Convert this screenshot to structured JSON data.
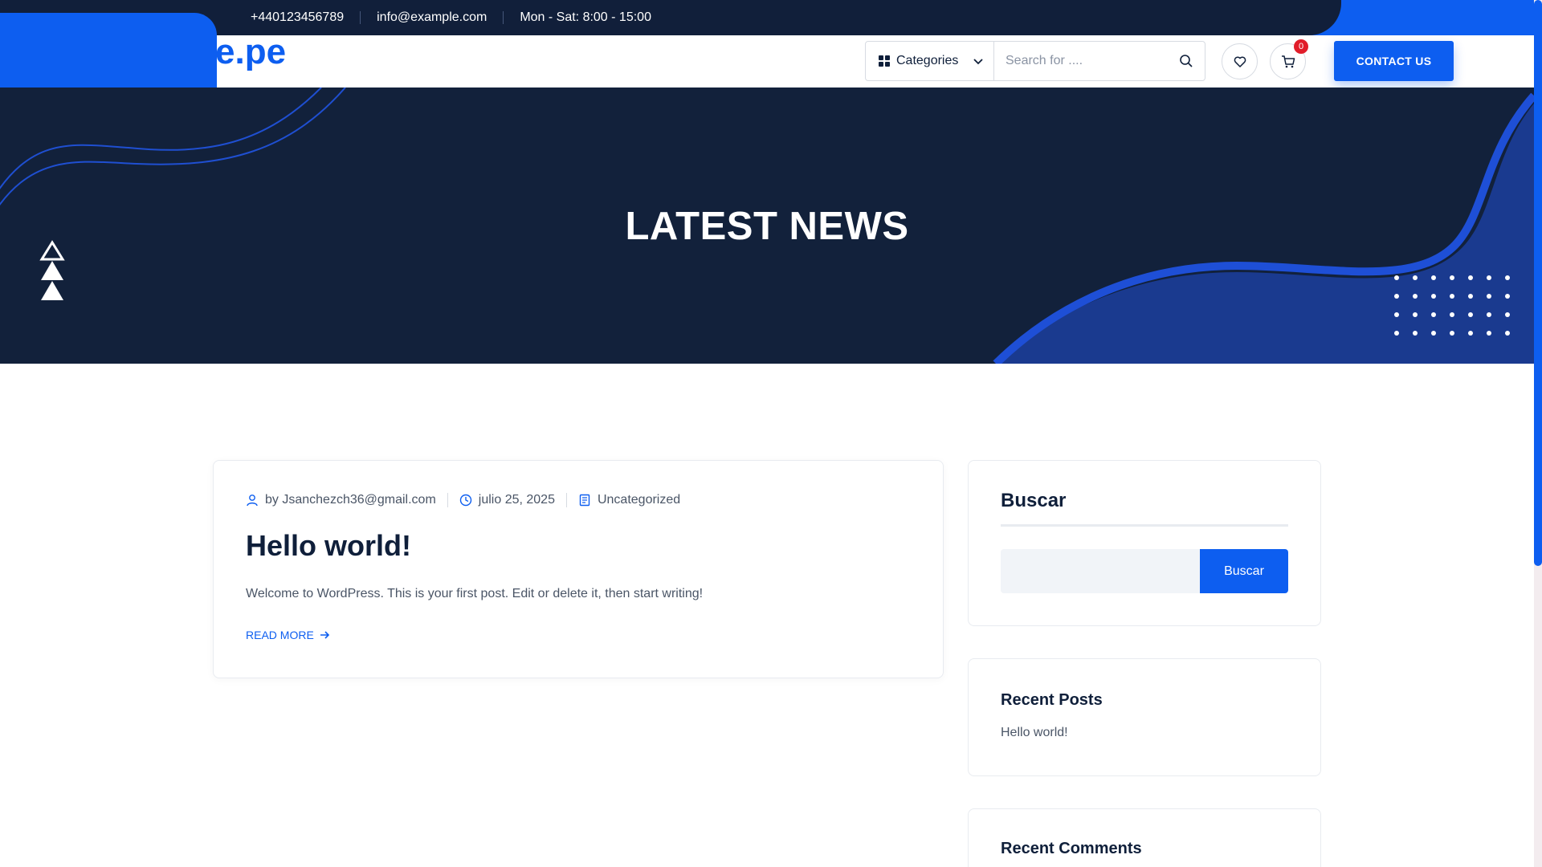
{
  "topbar": {
    "phone": "+440123456789",
    "email": "info@example.com",
    "hours": "Mon - Sat: 8:00 - 15:00"
  },
  "logo": {
    "text": "e.pe"
  },
  "header": {
    "categories_label": "Categories",
    "search_placeholder": "Search for ....",
    "cart_count": "0",
    "contact_label": "CONTACT US"
  },
  "hero": {
    "title": "LATEST NEWS"
  },
  "post": {
    "author": "by Jsanchezch36@gmail.com",
    "date": "julio 25, 2025",
    "category": "Uncategorized",
    "title": "Hello world!",
    "excerpt": "Welcome to WordPress. This is your first post. Edit or delete it, then start writing!",
    "read_more": "READ MORE"
  },
  "sidebar": {
    "search_title": "Buscar",
    "search_button": "Buscar",
    "recent_posts_title": "Recent Posts",
    "recent_posts": [
      "Hello world!"
    ],
    "recent_comments_title": "Recent Comments"
  },
  "colors": {
    "primary": "#0d5ef0",
    "dark": "#12213b",
    "badge": "#e11d2a"
  }
}
